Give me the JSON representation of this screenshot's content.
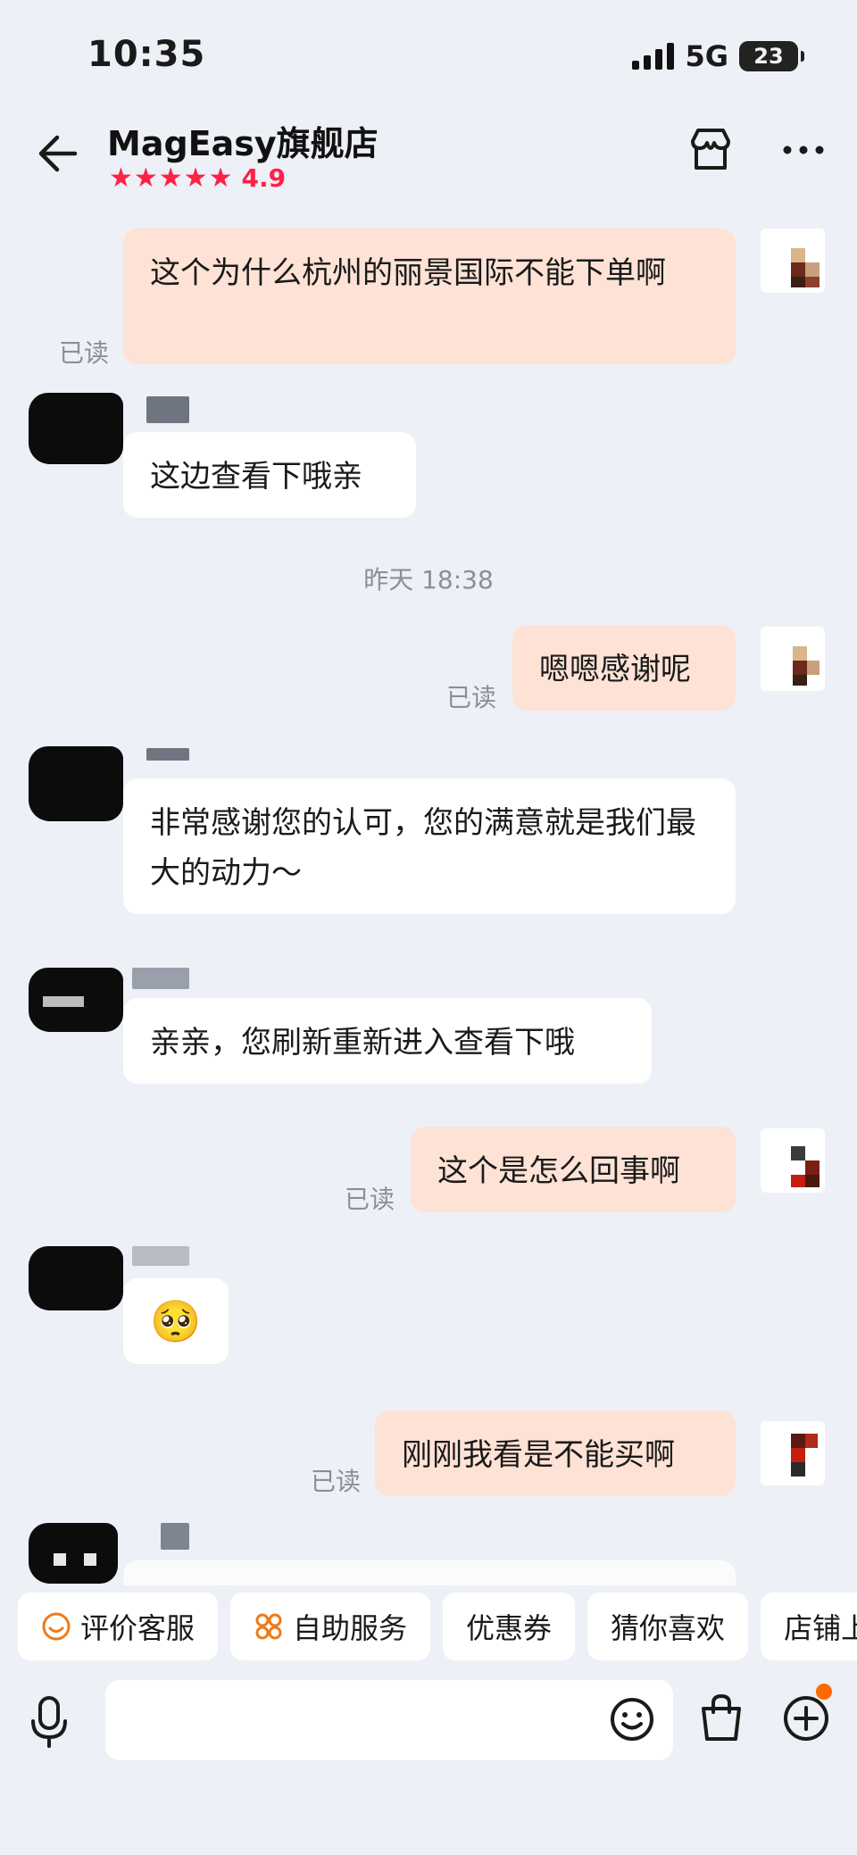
{
  "status": {
    "time": "10:35",
    "network": "5G",
    "battery": "23"
  },
  "header": {
    "shop_name": "MagEasy旗舰店",
    "stars": "★★★★★",
    "rating": "4.9"
  },
  "messages": [
    {
      "from": "me",
      "text": "这个为什么杭州的丽景国际不能下单啊",
      "read": "已读"
    },
    {
      "from": "them",
      "text": "这边查看下哦亲"
    },
    {
      "from": "me",
      "text": "嗯嗯感谢呢",
      "read": "已读"
    },
    {
      "from": "them",
      "text": "非常感谢您的认可，您的满意就是我们最大的动力～"
    },
    {
      "from": "them",
      "text": "亲亲，您刷新重新进入查看下哦"
    },
    {
      "from": "me",
      "text": "这个是怎么回事啊",
      "read": "已读"
    },
    {
      "from": "them",
      "text": "🥺"
    },
    {
      "from": "me",
      "text": "刚刚我看是不能买啊",
      "read": "已读"
    }
  ],
  "timestamp": "昨天 18:38",
  "quick_actions": [
    {
      "label": "评价客服",
      "icon": "smile-icon"
    },
    {
      "label": "自助服务",
      "icon": "grid-icon"
    },
    {
      "label": "优惠券"
    },
    {
      "label": "猜你喜欢"
    },
    {
      "label": "店铺上"
    }
  ],
  "colors": {
    "accent": "#ff2146",
    "my_bubble": "#fde2d5",
    "background": "#edf0f6",
    "badge": "#ff6a00"
  }
}
